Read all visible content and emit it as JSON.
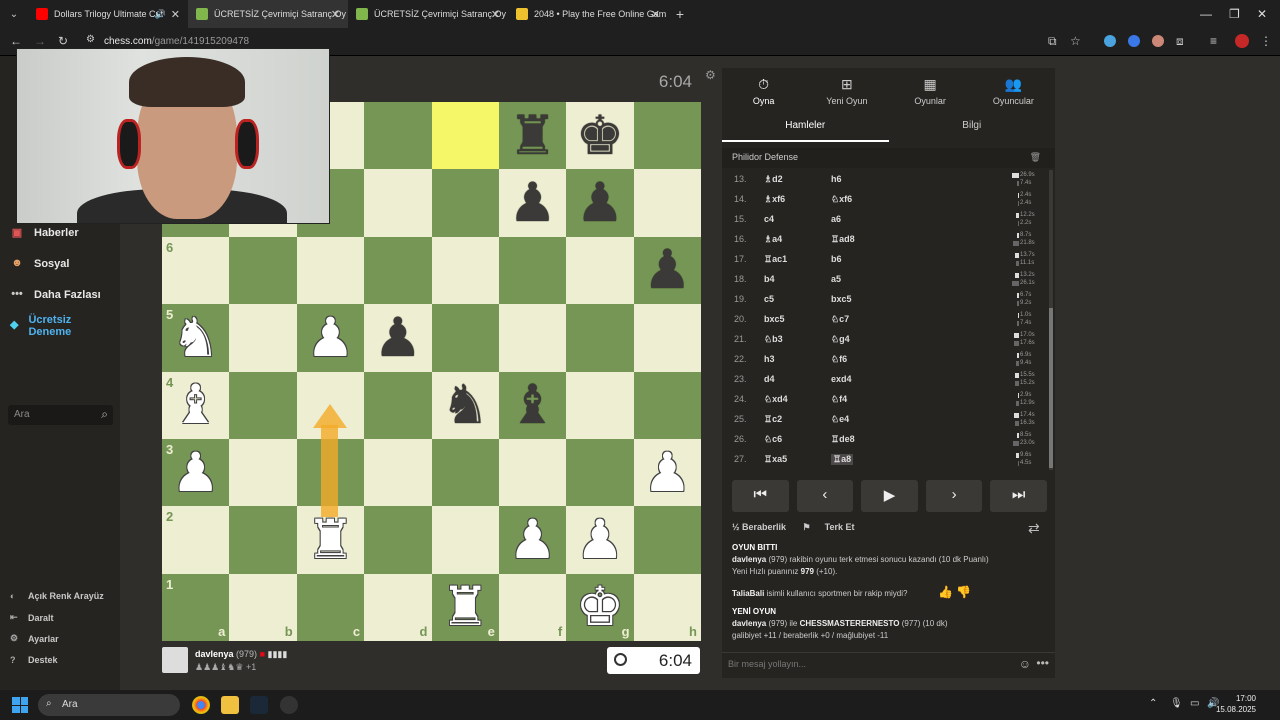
{
  "browser": {
    "tabs": [
      {
        "title": "Dollars Trilogy Ultimate Cut",
        "color": "#ff0000"
      },
      {
        "title": "ÜCRETSİZ Çevrimiçi Satranç Oy",
        "color": "#81b64c"
      },
      {
        "title": "ÜCRETSİZ Çevrimiçi Satranç Oy",
        "color": "#81b64c"
      },
      {
        "title": "2048 • Play the Free Online Gam",
        "color": "#edc22e"
      }
    ],
    "url_host": "chess.com",
    "url_path": "/game/141915209478"
  },
  "sidebar": {
    "items": [
      {
        "label": "Haberler",
        "icon": "news-icon"
      },
      {
        "label": "Sosyal",
        "icon": "social-icon"
      },
      {
        "label": "Daha Fazlası",
        "icon": "more-icon"
      },
      {
        "label": "Ücretsiz Deneme",
        "icon": "diamond-icon"
      }
    ],
    "search_placeholder": "Ara",
    "bottom": [
      {
        "label": "Açık Renk Arayüz",
        "icon": "theme-toggle-icon"
      },
      {
        "label": "Daralt",
        "icon": "collapse-icon"
      },
      {
        "label": "Ayarlar",
        "icon": "gear-icon"
      },
      {
        "label": "Destek",
        "icon": "help-icon"
      }
    ]
  },
  "game": {
    "top_clock": "6:04",
    "bottom_clock": "6:04",
    "player": {
      "name": "davlenya",
      "rating": "(979)",
      "captured_extra": "+1"
    },
    "ranks_shown": [
      "6",
      "5",
      "4",
      "3",
      "2",
      "1"
    ],
    "files": [
      "a",
      "b",
      "c",
      "d",
      "e",
      "f",
      "g",
      "h"
    ]
  },
  "panel": {
    "tabs": [
      {
        "label": "Oyna",
        "icon": "clock-icon"
      },
      {
        "label": "Yeni Oyun",
        "icon": "plus-icon"
      },
      {
        "label": "Oyunlar",
        "icon": "board-icon"
      },
      {
        "label": "Oyuncular",
        "icon": "people-icon"
      }
    ],
    "subtabs": [
      "Hamleler",
      "Bilgi"
    ],
    "opening": "Philidor Defense",
    "moves": [
      {
        "n": "13.",
        "w": "♗d2",
        "b": "h6",
        "tw": "26.9s",
        "tb": "7.4s"
      },
      {
        "n": "14.",
        "w": "♗xf6",
        "b": "♘xf6",
        "tw": "2.4s",
        "tb": "2.4s"
      },
      {
        "n": "15.",
        "w": "c4",
        "b": "a6",
        "tw": "12.2s",
        "tb": "2.2s"
      },
      {
        "n": "16.",
        "w": "♗a4",
        "b": "♖ad8",
        "tw": "8.7s",
        "tb": "21.8s"
      },
      {
        "n": "17.",
        "w": "♖ac1",
        "b": "b6",
        "tw": "13.7s",
        "tb": "11.1s"
      },
      {
        "n": "18.",
        "w": "b4",
        "b": "a5",
        "tw": "13.2s",
        "tb": "26.1s"
      },
      {
        "n": "19.",
        "w": "c5",
        "b": "bxc5",
        "tw": "6.7s",
        "tb": "9.2s"
      },
      {
        "n": "20.",
        "w": "bxc5",
        "b": "♘c7",
        "tw": "1.0s",
        "tb": "7.4s"
      },
      {
        "n": "21.",
        "w": "♘b3",
        "b": "♘g4",
        "tw": "17.0s",
        "tb": "17.6s"
      },
      {
        "n": "22.",
        "w": "h3",
        "b": "♘f6",
        "tw": "6.9s",
        "tb": "9.4s"
      },
      {
        "n": "23.",
        "w": "d4",
        "b": "exd4",
        "tw": "15.5s",
        "tb": "15.2s"
      },
      {
        "n": "24.",
        "w": "♘xd4",
        "b": "♘f4",
        "tw": "2.9s",
        "tb": "12.9s"
      },
      {
        "n": "25.",
        "w": "♖c2",
        "b": "♘e4",
        "tw": "17.4s",
        "tb": "16.3s"
      },
      {
        "n": "26.",
        "w": "♘c6",
        "b": "♖de8",
        "tw": "8.5s",
        "tb": "23.0s"
      },
      {
        "n": "27.",
        "w": "♖xa5",
        "b": "♖a8",
        "tw": "9.6s",
        "tb": "4.5s"
      }
    ],
    "actions": [
      "½ Beraberlik",
      "Terk Et"
    ],
    "chat": {
      "over_header": "OYUN BITTI",
      "result_name": "davlenya",
      "result_text": "(979) rakibin oyunu terk etmesi sonucu kazandı (10 dk Puanlı)",
      "rating_line_pre": "Yeni Hızlı puanınız ",
      "rating_value": "979",
      "rating_line_post": " (+10).",
      "question_name": "TaliaBali",
      "question_text": " isimli kullanıcı sportmen bir rakip miydi?",
      "new_game_header": "YENİ OYUN",
      "new_game_name": "davlenya",
      "new_game_mid": " (979) ile ",
      "new_game_opp": "CHESSMASTERERNESTO",
      "new_game_tail": " (977) (10 dk)",
      "record": "galibiyet +11 / beraberlik +0 / mağlubiyet -11"
    },
    "chat_placeholder": "Bir mesaj yollayın..."
  },
  "taskbar": {
    "search": "Ara",
    "time": "17:00",
    "date": "15.08.2025"
  }
}
